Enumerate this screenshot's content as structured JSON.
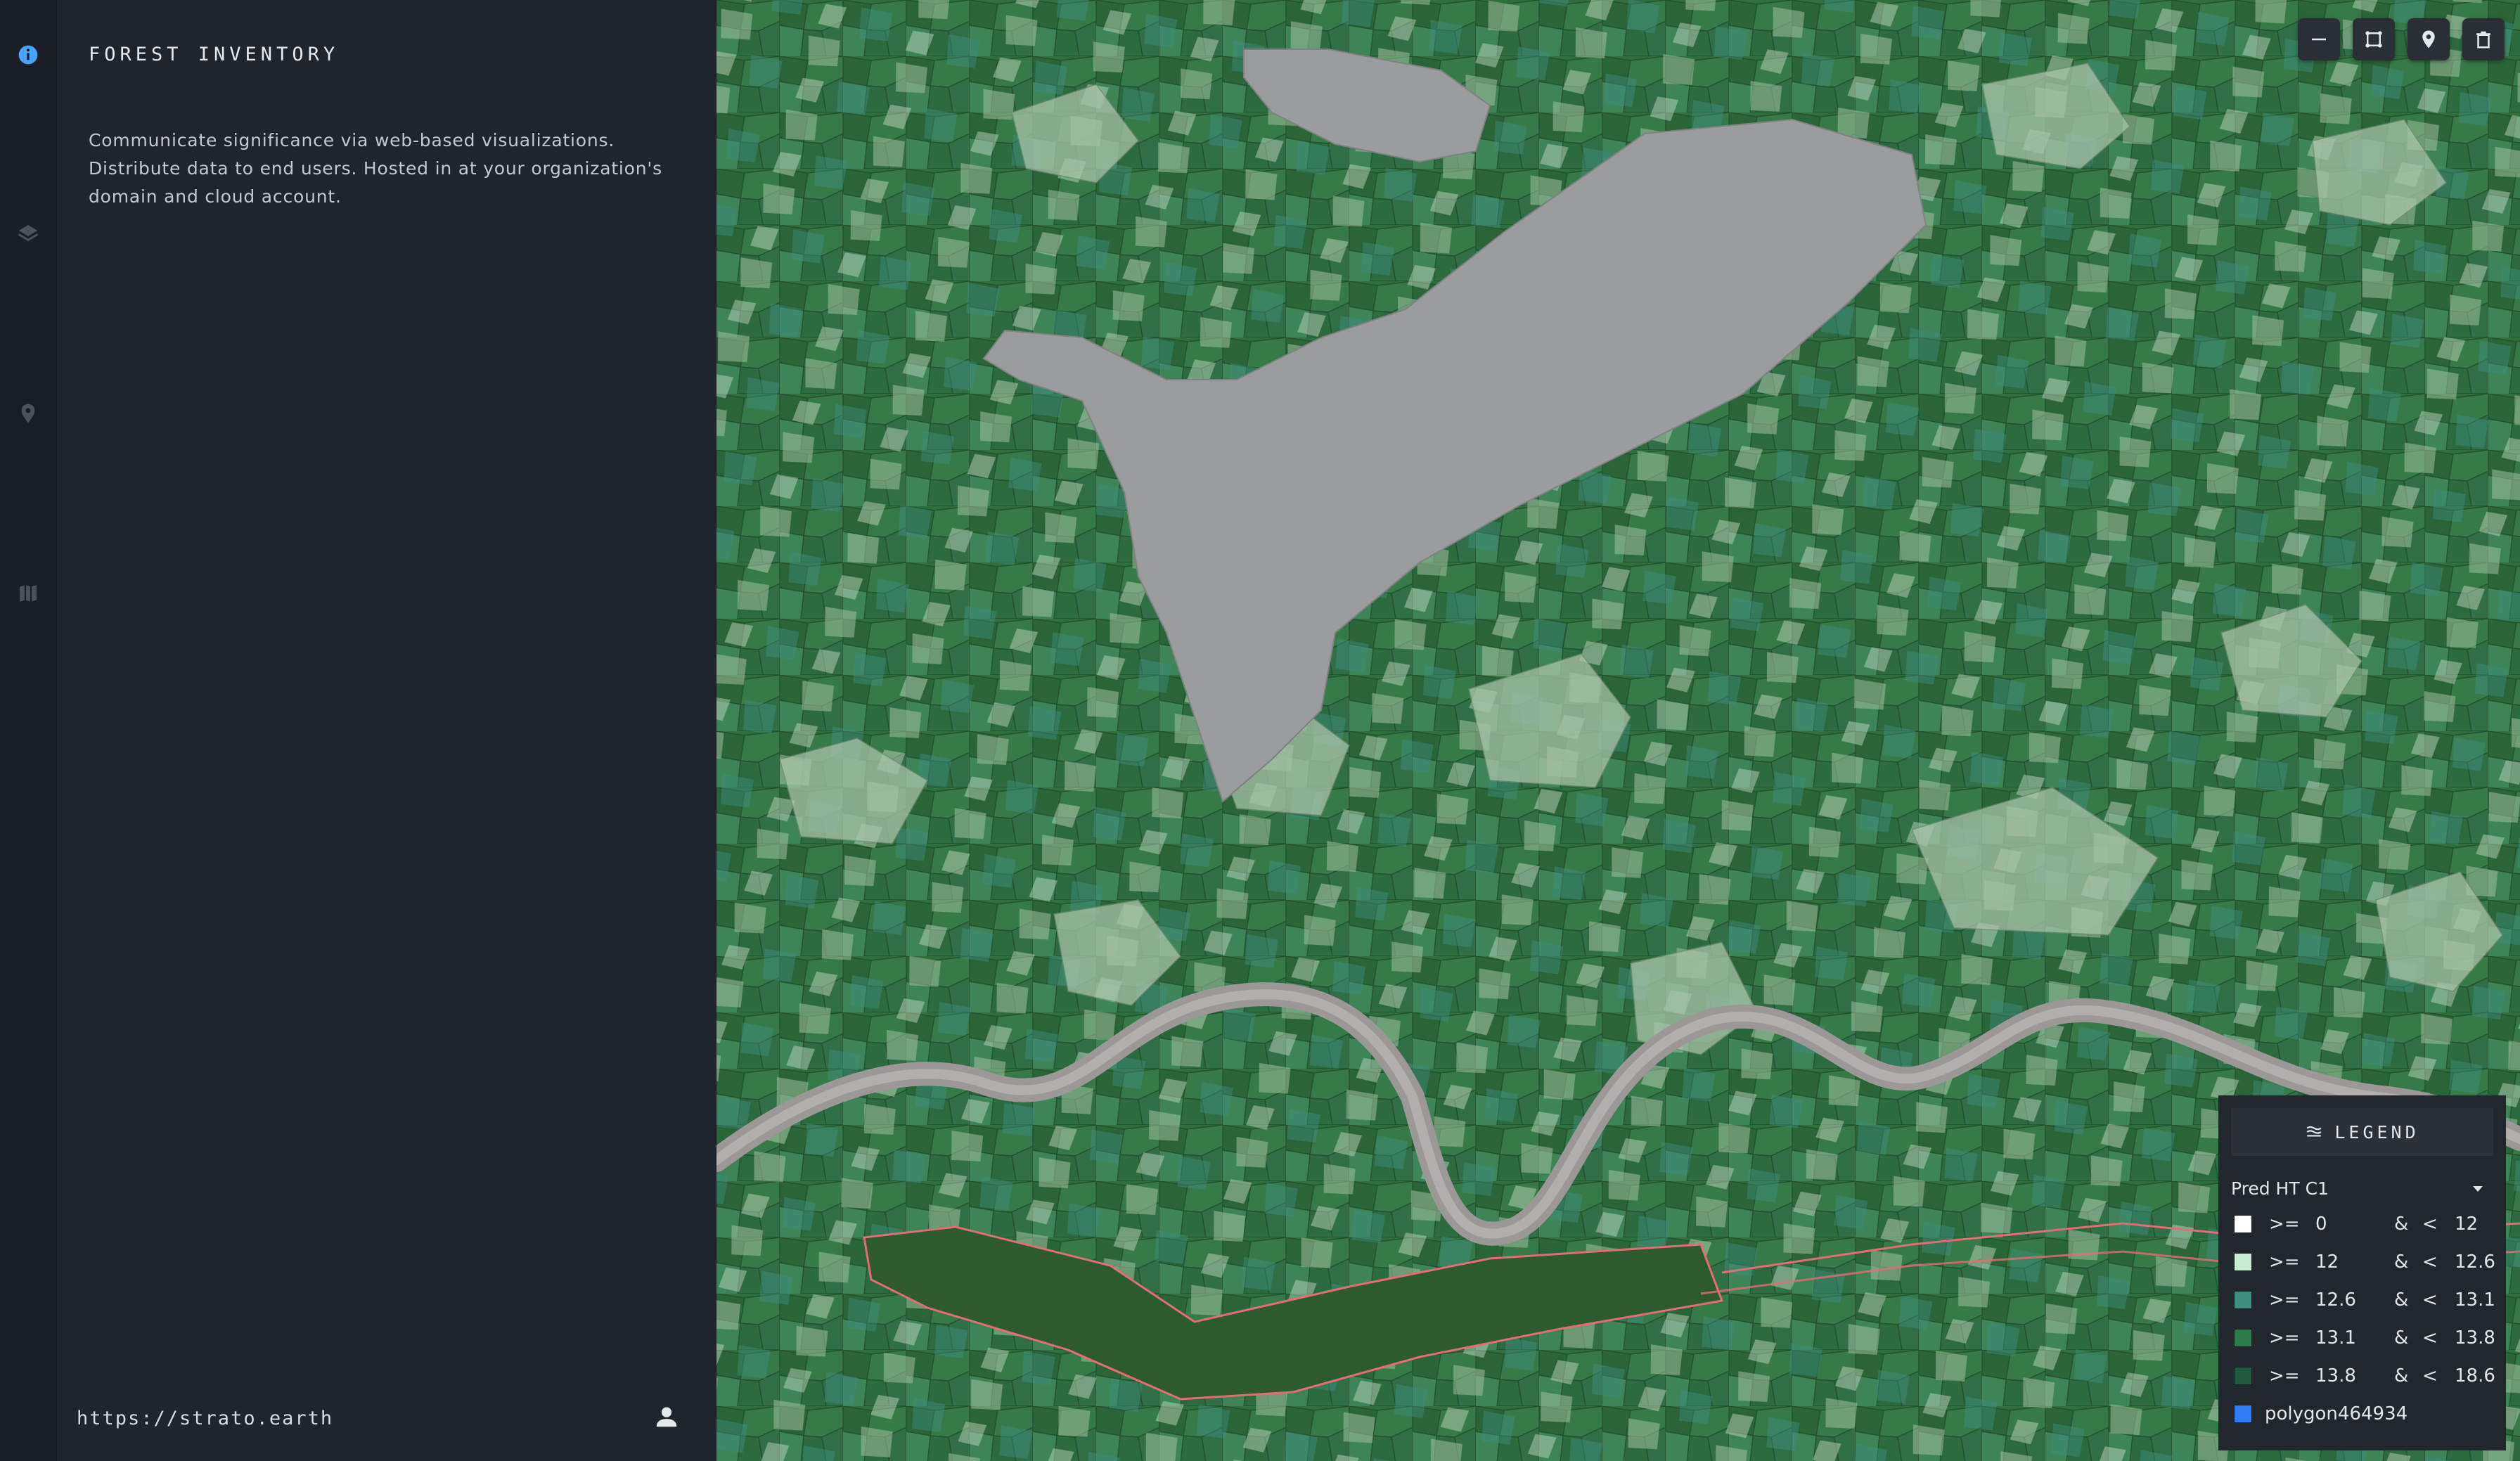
{
  "app": {
    "title": "FOREST INVENTORY",
    "description": "Communicate significance via web-based visualizations. Distribute data to end users. Hosted in at your organization's domain and cloud account.",
    "footer_url": "https://strato.earth"
  },
  "rail": {
    "items": [
      {
        "icon": "info-icon",
        "active": true
      },
      {
        "icon": "layers-icon",
        "active": false
      },
      {
        "icon": "map-pin-icon",
        "active": false
      },
      {
        "icon": "map-icon",
        "active": false
      }
    ]
  },
  "map_tools": [
    "line-icon",
    "polygon-icon",
    "point-icon",
    "trash-icon"
  ],
  "legend": {
    "header": "LEGEND",
    "selected_layer": "Pred HT C1",
    "rows": [
      {
        "op1": ">=",
        "min": "0",
        "amp": "&",
        "op2": "<",
        "max": "12",
        "color": "#ffffff"
      },
      {
        "op1": ">=",
        "min": "12",
        "amp": "&",
        "op2": "<",
        "max": "12.6",
        "color": "#c8ecd2"
      },
      {
        "op1": ">=",
        "min": "12.6",
        "amp": "&",
        "op2": "<",
        "max": "13.1",
        "color": "#3f8f80"
      },
      {
        "op1": ">=",
        "min": "13.1",
        "amp": "&",
        "op2": "<",
        "max": "13.8",
        "color": "#2e7a4a"
      },
      {
        "op1": ">=",
        "min": "13.8",
        "amp": "&",
        "op2": "<",
        "max": "18.6",
        "color": "#235a3f"
      }
    ],
    "polygon": {
      "label": "polygon464934",
      "color": "#2f7cf6"
    }
  },
  "colors": {
    "accent": "#4aa3ff",
    "selection_outline": "#e56b74",
    "water": "#9a9c9d"
  }
}
